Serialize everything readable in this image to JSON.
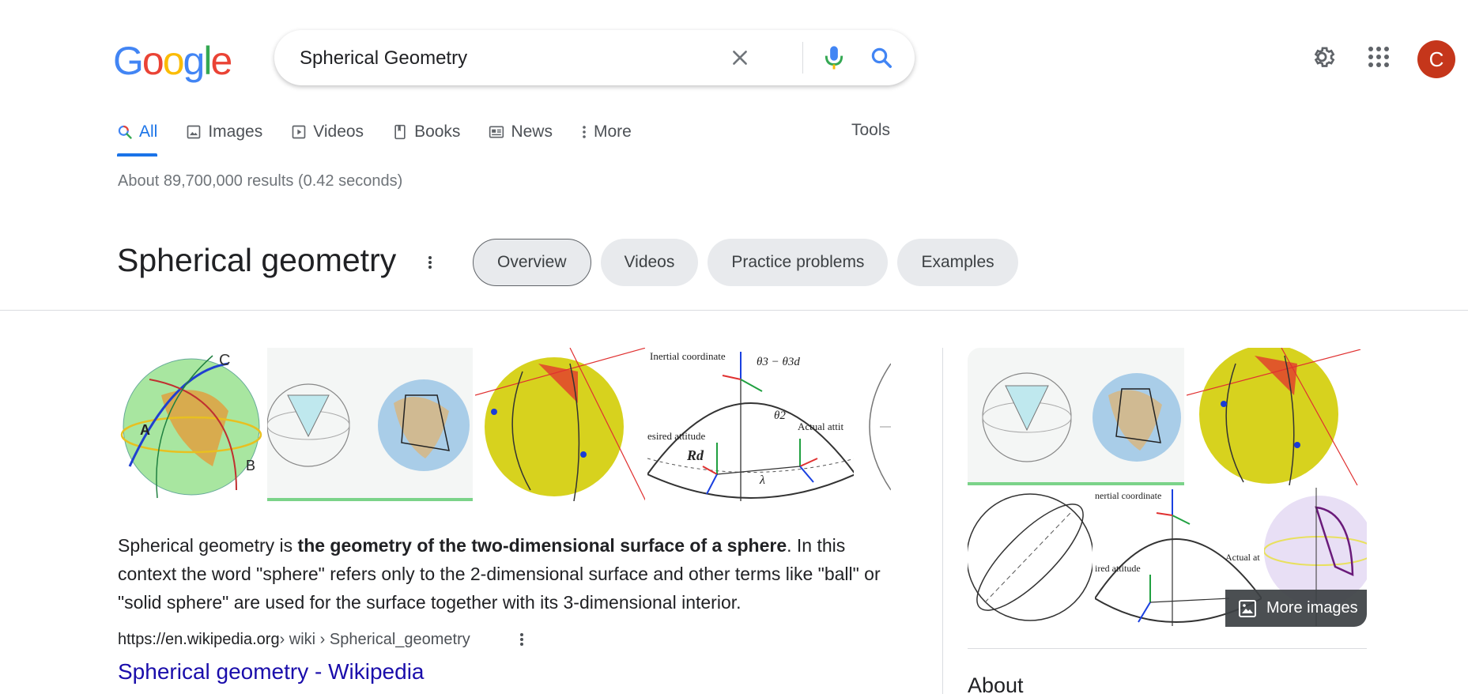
{
  "logo": [
    "G",
    "o",
    "o",
    "g",
    "l",
    "e"
  ],
  "search": {
    "query": "Spherical Geometry"
  },
  "header": {
    "avatar_letter": "C"
  },
  "tabs": [
    {
      "label": "All",
      "icon": "search-icon"
    },
    {
      "label": "Images",
      "icon": "image-icon"
    },
    {
      "label": "Videos",
      "icon": "play-icon"
    },
    {
      "label": "Books",
      "icon": "book-icon"
    },
    {
      "label": "News",
      "icon": "news-icon"
    },
    {
      "label": "More",
      "icon": "more-vert-icon"
    }
  ],
  "tools_label": "Tools",
  "stats": "About 89,700,000 results (0.42 seconds)",
  "kp": {
    "title": "Spherical geometry",
    "chips": [
      "Overview",
      "Videos",
      "Practice problems",
      "Examples"
    ]
  },
  "strip_text": {
    "c_label": "C",
    "a_label": "A",
    "b_label": "B",
    "inertial": "Inertial coordinate",
    "theta_formula": "θ3 − θ3d",
    "actual": "Actual attit",
    "desired": "esired attitude",
    "theta2": "θ2",
    "rd": "Rd",
    "lambda": "λ"
  },
  "desc": {
    "pre": "Spherical geometry is ",
    "bold": "the geometry of the two-dimensional surface of a sphere",
    "post": ". In this context the word \"sphere\" refers only to the 2-dimensional surface and other terms like \"ball\" or \"solid sphere\" are used for the surface together with its 3-dimensional interior."
  },
  "source": {
    "host": "https://en.wikipedia.org",
    "path": " › wiki › Spherical_geometry"
  },
  "result_title": "Spherical geometry - Wikipedia",
  "right": {
    "more_images": "More images",
    "about": "About",
    "inertial": "nertial coordinate",
    "desired": "ired attitude",
    "actual": "Actual at"
  }
}
